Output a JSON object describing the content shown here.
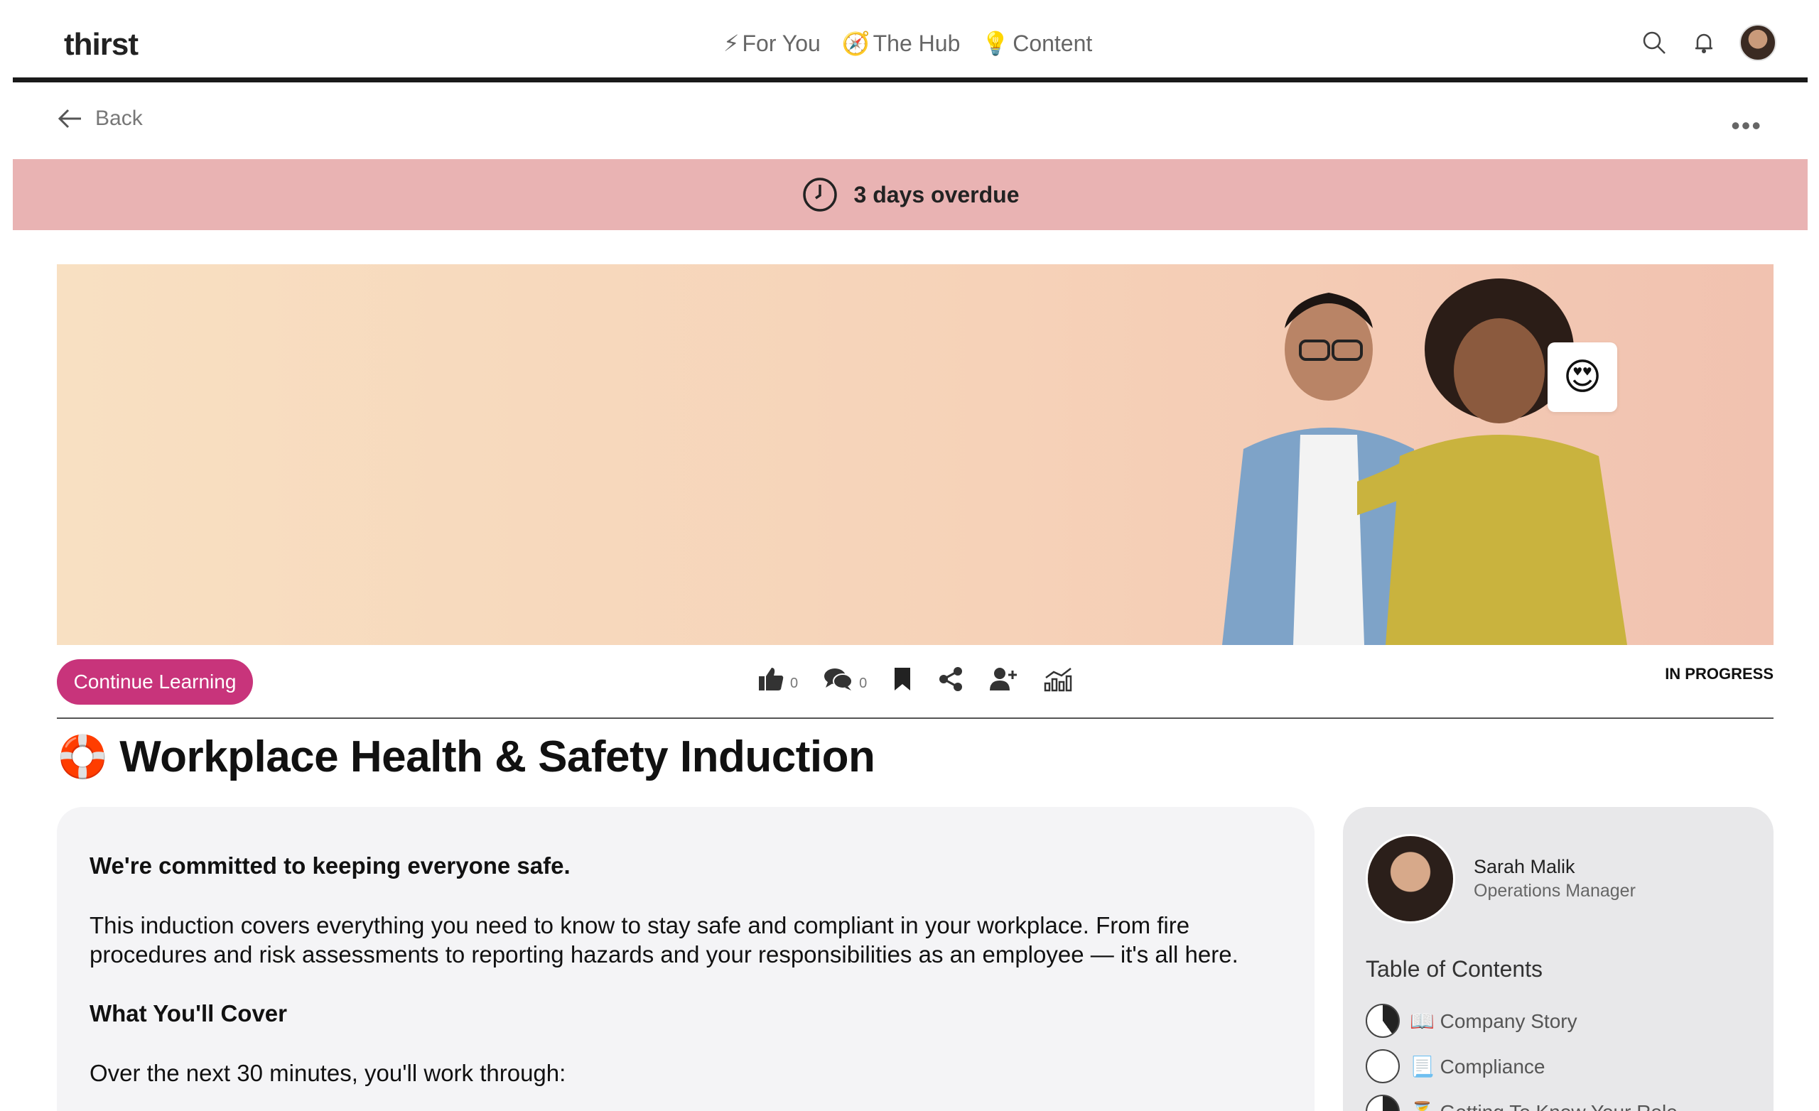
{
  "brand": "thirst",
  "nav": {
    "items": [
      {
        "icon": "⚡",
        "label": "For You"
      },
      {
        "icon": "🧭",
        "label": "The Hub"
      },
      {
        "icon": "💡",
        "label": "Content"
      }
    ]
  },
  "back_label": "Back",
  "overdue_text": "3 days overdue",
  "hero_emoji": "😍",
  "continue_label": "Continue Learning",
  "actions": {
    "like_count": "0",
    "comment_count": "0"
  },
  "status": "IN PROGRESS",
  "title_emoji": "🛟",
  "title": "Workplace Health & Safety Induction",
  "body": {
    "heading1": "We're committed to keeping everyone safe.",
    "paragraph1": "This induction covers everything you need to know to stay safe and compliant in your workplace. From fire procedures and risk assessments to reporting hazards and your responsibilities as an employee — it's all here.",
    "heading2": "What You'll Cover",
    "paragraph2": "Over the next 30 minutes, you'll work through:"
  },
  "author": {
    "name": "Sarah Malik",
    "role": "Operations Manager"
  },
  "toc": {
    "title": "Table of Contents",
    "items": [
      {
        "label": "📖 Company Story",
        "progress": 0.4
      },
      {
        "label": "📃 Compliance",
        "progress": 0
      },
      {
        "label": "⏳ Getting To Know Your Role",
        "progress": 0.4
      }
    ]
  },
  "colors": {
    "accent": "#c8347b",
    "overdue_bg": "#e9b3b3"
  }
}
